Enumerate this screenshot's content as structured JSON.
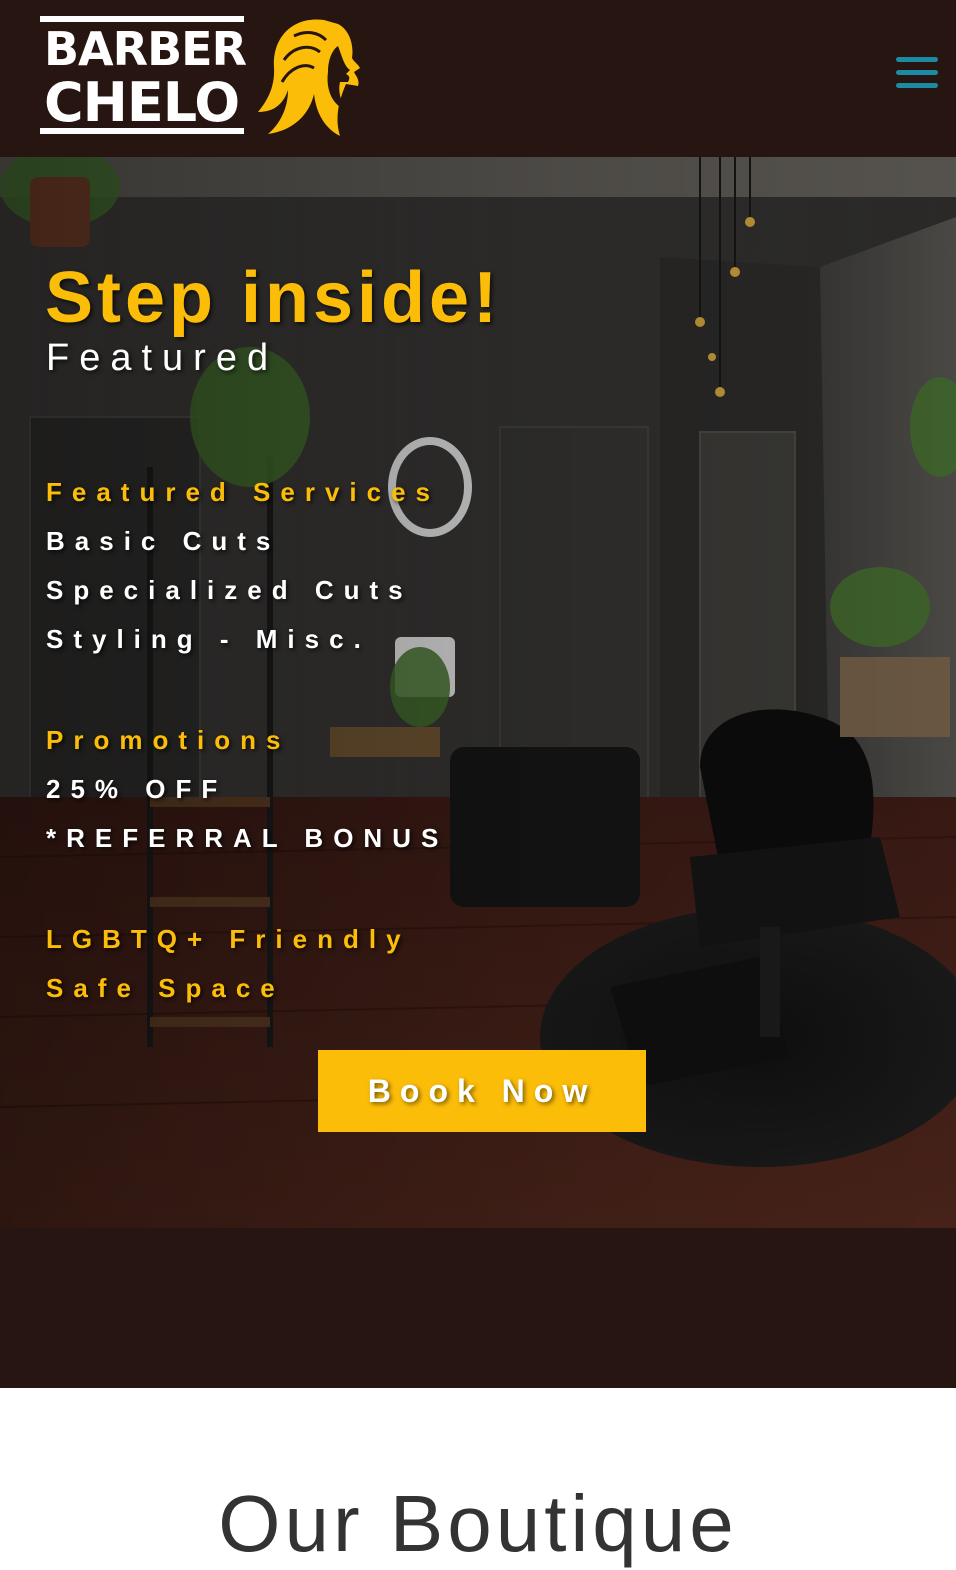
{
  "brand": {
    "line1": "BARBER",
    "line2": "CHELO",
    "logo_icon": "woman-silhouette-icon",
    "accent_color": "#fbbd08",
    "header_bg": "#261510"
  },
  "nav": {
    "menu_icon": "hamburger-menu-icon",
    "menu_color": "#1d8aa3"
  },
  "hero": {
    "title": "Step inside!",
    "subtitle": "Featured",
    "services": {
      "heading": "Featured Services",
      "items": [
        "Basic Cuts",
        "Specialized Cuts",
        "Styling - Misc."
      ]
    },
    "promotions": {
      "heading": "Promotions",
      "items": [
        "25% OFF",
        "*REFERRAL BONUS"
      ]
    },
    "badges": [
      "LGBTQ+ Friendly",
      "Safe Space"
    ],
    "cta_label": "Book Now"
  },
  "next_section": {
    "title": "Our Boutique"
  }
}
